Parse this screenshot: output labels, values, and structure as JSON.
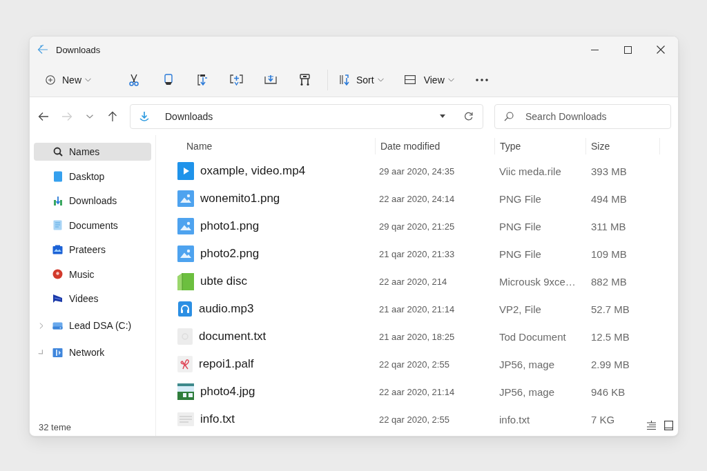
{
  "window": {
    "title": "Downloads"
  },
  "toolbar": {
    "new_button": {
      "label": "New"
    },
    "sort_button": {
      "label": "Sort"
    },
    "view_button": {
      "label": "View"
    }
  },
  "navigation": [
    {
      "kind": "back",
      "disabled": false
    },
    {
      "kind": "forward",
      "disabled": true
    },
    {
      "kind": "recent",
      "disabled": false
    },
    {
      "kind": "up",
      "disabled": false
    }
  ],
  "address_bar": {
    "location": "Downloads"
  },
  "search": {
    "placeholder": "Search Downloads"
  },
  "sidebar": {
    "items": [
      {
        "kind": "search",
        "label": "Names",
        "selected": true
      },
      {
        "kind": "desktop",
        "label": "Dasktop",
        "selected": false
      },
      {
        "kind": "downloads",
        "label": "Downloads",
        "selected": false
      },
      {
        "kind": "documents",
        "label": "Documents",
        "selected": false
      },
      {
        "kind": "pictures",
        "label": "Prateers",
        "selected": false
      },
      {
        "kind": "music",
        "label": "Music",
        "selected": false
      },
      {
        "kind": "videos",
        "label": "Videes",
        "selected": false
      },
      {
        "kind": "drive",
        "label": "Lead DSA (C:)",
        "selected": false,
        "expanded": false
      },
      {
        "kind": "network",
        "label": "Network",
        "selected": false,
        "expanded": true
      }
    ],
    "status": "32 teme"
  },
  "file_list": {
    "columns": [
      "Name",
      "Date modified",
      "Type",
      "Size"
    ],
    "rows": [
      {
        "kind": "video",
        "name": "oxample, video.mp4",
        "date": "29 aar 2020, 24:35",
        "type": "Viic meda.rile",
        "size": "393 MB"
      },
      {
        "kind": "image",
        "name": "wonemito1.png",
        "date": "22 aar 2020, 24:14",
        "type": "PNG File",
        "size": "494 MB"
      },
      {
        "kind": "image",
        "name": "photo1.png",
        "date": "29 qar 2020, 21:25",
        "type": "PNG File",
        "size": "311 MB"
      },
      {
        "kind": "image",
        "name": "photo2.png",
        "date": "21 qar 2020, 21:33",
        "type": "PNG File",
        "size": "109 MB"
      },
      {
        "kind": "book",
        "name": "ubte disc",
        "date": "22 aar 2020, 214",
        "type": "Microusk 9xce…",
        "size": "882 MB"
      },
      {
        "kind": "audio",
        "name": "audio.mp3",
        "date": "21 aar 2020, 21:14",
        "type": "VP2, File",
        "size": "52.7 MB"
      },
      {
        "kind": "blank",
        "name": "document.txt",
        "date": "21 aar 2020, 18:25",
        "type": "Tod Document",
        "size": "12.5 MB"
      },
      {
        "kind": "ribbon",
        "name": "repoi1.palf",
        "date": "22 qar 2020, 2:55",
        "type": "JP56, mage",
        "size": "2.99 MB"
      },
      {
        "kind": "photo",
        "name": "photo4.jpg",
        "date": "22 aar 2020, 21:14",
        "type": "JP56, mage",
        "size": "946 KB"
      },
      {
        "kind": "text",
        "name": "info.txt",
        "date": "22 qar 2020, 2:55",
        "type": "info.txt",
        "size": "7 KG"
      }
    ]
  }
}
